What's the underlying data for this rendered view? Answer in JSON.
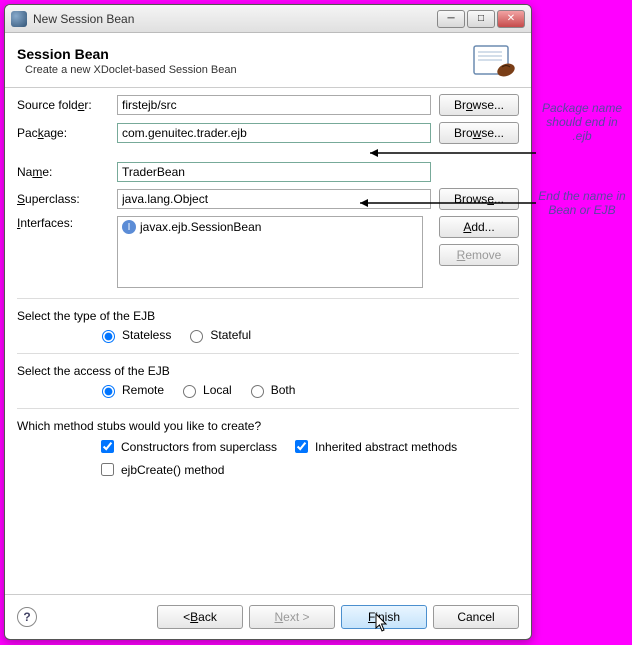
{
  "window": {
    "title": "New Session Bean"
  },
  "header": {
    "title": "Session Bean",
    "subtitle": "Create a new XDoclet-based Session Bean"
  },
  "fields": {
    "source_folder_label": "Source folder:",
    "source_folder_label_u": "r",
    "source_folder_label_post": ":",
    "source_folder_value": "firstejb/src",
    "package_label": "Package:",
    "package_value": "com.genuitec.trader.ejb",
    "name_label": "Name:",
    "name_value": "TraderBean",
    "superclass_label": "Superclass:",
    "superclass_value": "java.lang.Object",
    "interfaces_label": "Interfaces:",
    "interface_item": "javax.ejb.SessionBean"
  },
  "buttons": {
    "browse1": "Browse...",
    "browse2": "Browse...",
    "browse3": "Browse...",
    "add": "Add...",
    "remove": "Remove",
    "back": "< Back",
    "next": "Next >",
    "finish": "Finish",
    "cancel": "Cancel"
  },
  "groups": {
    "type_title": "Select the type of the EJB",
    "type_stateless": "Stateless",
    "type_stateful": "Stateful",
    "access_title": "Select the access of the EJB",
    "access_remote": "Remote",
    "access_local": "Local",
    "access_both": "Both",
    "stubs_title": "Which method stubs would you like to create?",
    "stub_ctors": "Constructors from superclass",
    "stub_abs": "Inherited abstract methods",
    "stub_ejb": "ejbCreate() method"
  },
  "annotations": {
    "package": "Package name should end in .ejb",
    "name": "End the name in Bean or EJB"
  }
}
